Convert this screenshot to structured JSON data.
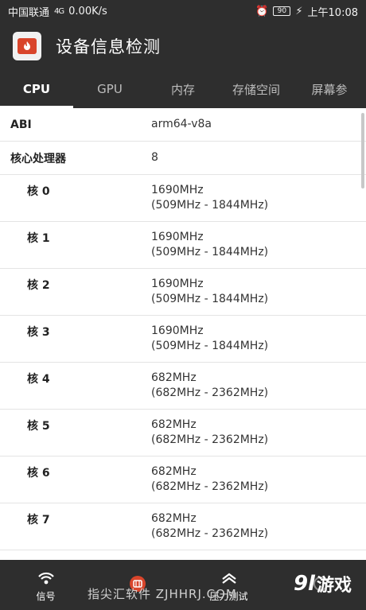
{
  "status_bar": {
    "carrier": "中国联通",
    "signal": "4G",
    "speed": "0.00K/s",
    "battery": "90",
    "time": "上午10:08"
  },
  "app": {
    "title": "设备信息检测"
  },
  "tabs": [
    {
      "label": "CPU",
      "active": true
    },
    {
      "label": "GPU",
      "active": false
    },
    {
      "label": "内存",
      "active": false
    },
    {
      "label": "存储空间",
      "active": false
    },
    {
      "label": "屏幕参",
      "active": false
    }
  ],
  "rows": {
    "abi": {
      "label": "ABI",
      "value": "arm64-v8a"
    },
    "cores_count": {
      "label": "核心处理器",
      "value": "8"
    },
    "cores": [
      {
        "label": "核 0",
        "freq": "1690MHz",
        "range": "(509MHz - 1844MHz)"
      },
      {
        "label": "核 1",
        "freq": "1690MHz",
        "range": "(509MHz - 1844MHz)"
      },
      {
        "label": "核 2",
        "freq": "1690MHz",
        "range": "(509MHz - 1844MHz)"
      },
      {
        "label": "核 3",
        "freq": "1690MHz",
        "range": "(509MHz - 1844MHz)"
      },
      {
        "label": "核 4",
        "freq": "682MHz",
        "range": "(682MHz - 2362MHz)"
      },
      {
        "label": "核 5",
        "freq": "682MHz",
        "range": "(682MHz - 2362MHz)"
      },
      {
        "label": "核 6",
        "freq": "682MHz",
        "range": "(682MHz - 2362MHz)"
      },
      {
        "label": "核 7",
        "freq": "682MHz",
        "range": "(682MHz - 2362MHz)"
      }
    ]
  },
  "bottom_nav": {
    "items": [
      {
        "label": "信号",
        "icon": "signal-icon"
      },
      {
        "label": "",
        "icon": "info-icon"
      },
      {
        "label": "压力测试",
        "icon": "stress-test-icon"
      },
      {
        "label": "",
        "icon": "more-icon"
      }
    ],
    "watermark": "指尖汇软件 ZJHHRJ.COM",
    "brand": {
      "num": "9l",
      "text": "游戏"
    }
  }
}
